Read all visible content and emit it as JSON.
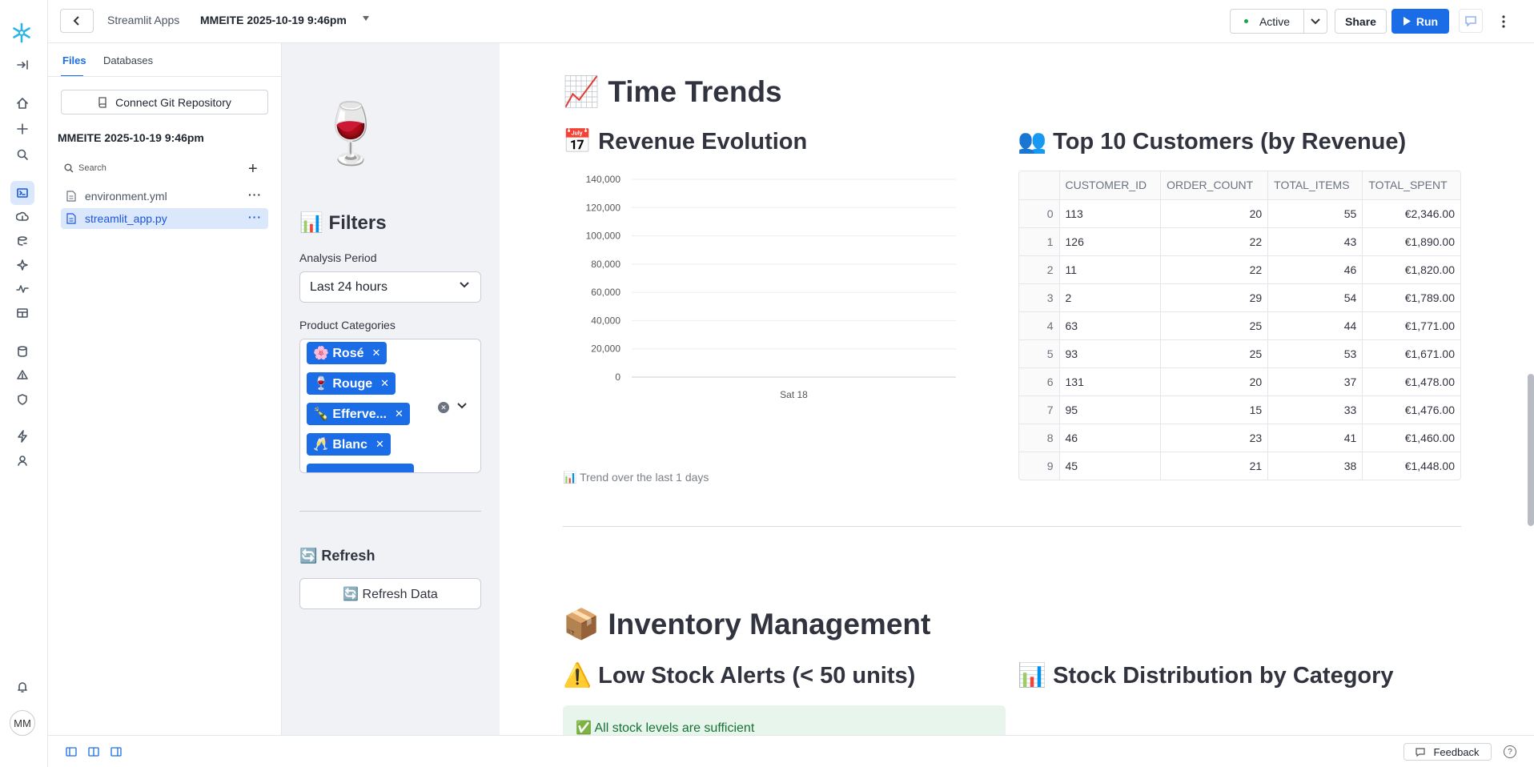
{
  "topbar": {
    "breadcrumb": "Streamlit Apps",
    "app_name": "MMEITE 2025-10-19 9:46pm",
    "status": "Active",
    "share": "Share",
    "run": "Run"
  },
  "filepanel": {
    "tabs": [
      "Files",
      "Databases"
    ],
    "git_button": "Connect Git Repository",
    "project": "MMEITE 2025-10-19 9:46pm",
    "search_placeholder": "Search",
    "files": [
      "environment.yml",
      "streamlit_app.py"
    ]
  },
  "sidebar": {
    "logo_emoji": "🍷",
    "filters_title": "📊 Filters",
    "period_label": "Analysis Period",
    "period_value": "Last 24 hours",
    "categories_label": "Product Categories",
    "categories": [
      "🌸 Rosé",
      "🍷 Rouge",
      "🍾 Efferve...",
      "🥂 Blanc"
    ],
    "refresh_title": "🔄 Refresh",
    "refresh_button": "🔄 Refresh Data"
  },
  "main": {
    "time_trends": "📈 Time Trends",
    "revenue_evolution": "📅 Revenue Evolution",
    "top_customers": "👥 Top 10 Customers (by Revenue)",
    "caption": "📊 Trend over the last 1 days",
    "inventory": "📦 Inventory Management",
    "low_stock": "⚠️ Low Stock Alerts (< 50 units)",
    "stock_distribution": "📊 Stock Distribution by Category",
    "stock_ok": "✅ All stock levels are sufficient"
  },
  "customers_table": {
    "columns": [
      "",
      "CUSTOMER_ID",
      "ORDER_COUNT",
      "TOTAL_ITEMS",
      "TOTAL_SPENT"
    ],
    "rows": [
      [
        "0",
        "113",
        "20",
        "55",
        "€2,346.00"
      ],
      [
        "1",
        "126",
        "22",
        "43",
        "€1,890.00"
      ],
      [
        "2",
        "11",
        "22",
        "46",
        "€1,820.00"
      ],
      [
        "3",
        "2",
        "29",
        "54",
        "€1,789.00"
      ],
      [
        "4",
        "63",
        "25",
        "44",
        "€1,771.00"
      ],
      [
        "5",
        "93",
        "25",
        "53",
        "€1,671.00"
      ],
      [
        "6",
        "131",
        "20",
        "37",
        "€1,478.00"
      ],
      [
        "7",
        "95",
        "15",
        "33",
        "€1,476.00"
      ],
      [
        "8",
        "46",
        "23",
        "41",
        "€1,460.00"
      ],
      [
        "9",
        "45",
        "21",
        "38",
        "€1,448.00"
      ]
    ]
  },
  "chart_data": {
    "type": "line",
    "title": "",
    "xlabel": "",
    "ylabel": "",
    "x_ticks": [
      "Sat 18"
    ],
    "y_ticks": [
      0,
      20000,
      40000,
      60000,
      80000,
      100000,
      120000,
      140000
    ],
    "y_tick_labels": [
      "0",
      "20,000",
      "40,000",
      "60,000",
      "80,000",
      "100,000",
      "120,000",
      "140,000"
    ],
    "ylim": [
      0,
      140000
    ],
    "series": [],
    "grid": true
  },
  "bottombar": {
    "feedback": "Feedback",
    "help": "?"
  },
  "colors": {
    "accent": "#1a6ce7",
    "active_dot": "#17a34a",
    "success_bg": "#e8f5ec"
  }
}
